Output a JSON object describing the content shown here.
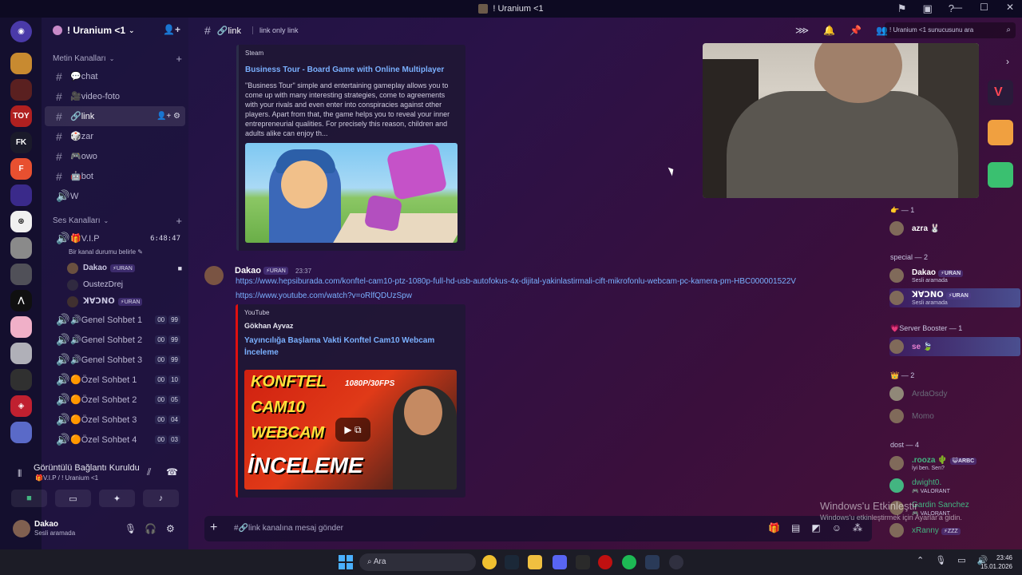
{
  "window": {
    "title": "! Uranium <1"
  },
  "server": {
    "name": "! Uranium <1"
  },
  "categories": {
    "text": "Metin Kanalları",
    "voice": "Ses Kanalları"
  },
  "text_channels": [
    {
      "label": "💬chat"
    },
    {
      "label": "🎥video-foto"
    },
    {
      "label": "🔗link"
    },
    {
      "label": "🎲zar"
    },
    {
      "label": "🎮owo"
    },
    {
      "label": "🤖bot"
    },
    {
      "label": "W"
    }
  ],
  "vip_channel": {
    "label": "🎁V.I.P",
    "timer": "6:48:47",
    "status": "Bir kanal durumu belirle"
  },
  "vip_users": [
    {
      "name": "Dakao",
      "tag": "⚡URAN"
    },
    {
      "name": "OustezDrej",
      "tag": ""
    },
    {
      "name": "ꓘꓯꓛꓠꓳ",
      "tag": "⚡URAN"
    }
  ],
  "voice_channels": [
    {
      "label": "🔊Genel Sohbet 1",
      "a": "00",
      "b": "99"
    },
    {
      "label": "🔊Genel Sohbet 2",
      "a": "00",
      "b": "99"
    },
    {
      "label": "🔊Genel Sohbet 3",
      "a": "00",
      "b": "99"
    },
    {
      "label": "🟠Özel Sohbet 1",
      "a": "00",
      "b": "10"
    },
    {
      "label": "🟠Özel Sohbet 2",
      "a": "00",
      "b": "05"
    },
    {
      "label": "🟠Özel Sohbet 3",
      "a": "00",
      "b": "04"
    },
    {
      "label": "🟠Özel Sohbet 4",
      "a": "00",
      "b": "03"
    }
  ],
  "voice_panel": {
    "title": "Görüntülü Bağlantı Kuruldu",
    "sub": "🎁V.I.P / ! Uranium <1"
  },
  "user_panel": {
    "name": "Dakao",
    "status": "Sesli aramada"
  },
  "channel_header": {
    "name": "🔗link",
    "topic": "link only link",
    "search_placeholder": "! Uranium <1 sunucusunu ara"
  },
  "embed_steam": {
    "provider": "Steam",
    "title": "Business Tour - Board Game with Online Multiplayer",
    "description": "\"Business Tour\" simple and entertaining gameplay allows you to come up with many interesting strategies, come to agreements with your rivals and even enter into conspiracies against other players. Apart from that, the game helps you to reveal your inner entrepreneurial qualities. For precisely this reason, children and adults alike can enjoy th..."
  },
  "message": {
    "author": "Dakao",
    "tag": "⚡URAN",
    "time": "23:37",
    "link1": "https://www.hepsiburada.com/konftel-cam10-ptz-1080p-full-hd-usb-autofokus-4x-dijital-yakinlastirmali-cift-mikrofonlu-webcam-pc-kamera-pm-HBC000001522V",
    "link2": "https://www.youtube.com/watch?v=oRlfQDUzSpw"
  },
  "embed_youtube": {
    "provider": "YouTube",
    "author": "Gökhan Ayvaz",
    "title": "Yayıncılığa Başlama Vakti Konftel Cam10 Webcam İnceleme",
    "thumb_lines": [
      "KONFTEL",
      "CAM10",
      "WEBCAM",
      "İNCELEME"
    ],
    "thumb_res": "1080P/30FPS"
  },
  "members": {
    "groups": [
      {
        "label": "👉 — 1"
      },
      {
        "label": "special — 2"
      },
      {
        "label": "💗Server Booster — 1"
      },
      {
        "label": "👑 — 2"
      },
      {
        "label": "dost — 4"
      }
    ],
    "list": [
      {
        "name": "azra 🐰",
        "status": "",
        "tag": ""
      },
      {
        "name": "Dakao",
        "status": "Sesli aramada",
        "tag": "⚡URAN"
      },
      {
        "name": "ꓘꓯꓛꓠꓳ",
        "status": "Sesli aramada",
        "tag": "⚡URAN"
      },
      {
        "name": "se 🍃",
        "status": "",
        "tag": ""
      },
      {
        "name": "ArdaOsdy",
        "status": "",
        "tag": ""
      },
      {
        "name": "Momo",
        "status": "",
        "tag": ""
      },
      {
        "name": ".rooza 🌵",
        "status": "İyi ben. Sen?",
        "tag": "😺ARBC"
      },
      {
        "name": "dwight0.",
        "status": "🎮 VALORANT",
        "tag": ""
      },
      {
        "name": "Gardin Sanchez",
        "status": "🎮 VALORANT",
        "tag": ""
      },
      {
        "name": "xRanny",
        "status": "",
        "tag": "⚡ZZZ"
      }
    ]
  },
  "composer": {
    "placeholder": "#🔗link kanalına mesaj gönder"
  },
  "watermark": {
    "line1": "Windows'u Etkinleştir",
    "line2": "Windows'u etkinleştirmek için Ayarlar'a gidin."
  },
  "taskbar": {
    "search": "Ara",
    "time": "23:46",
    "date": "15.01.2026"
  },
  "colors": {
    "link": "#7ab0ff",
    "accent_red": "#e03a18",
    "background": "#2a1248"
  }
}
